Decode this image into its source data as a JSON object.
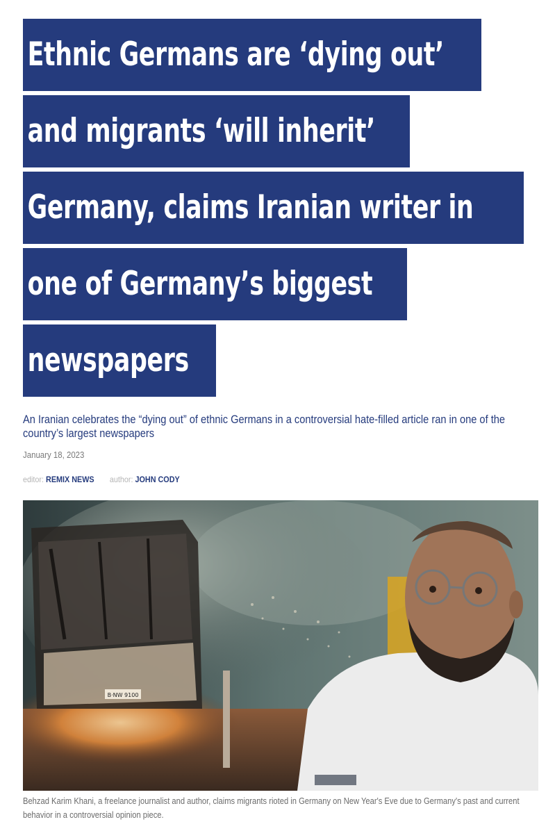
{
  "article": {
    "headline_lines": [
      "Ethnic Germans are ‘dying out’",
      "and migrants ‘will inherit’",
      "Germany, claims Iranian writer in",
      "one of Germany’s biggest",
      "newspapers"
    ],
    "subtitle": "An Iranian celebrates the “dying out” of ethnic Germans in a controversial hate-filled article ran in one of the country’s largest newspapers",
    "date": "January 18, 2023",
    "editor_label": "editor:",
    "editor_name": "REMIX NEWS",
    "author_label": "author:",
    "author_name": "JOHN CODY",
    "photo": {
      "license_plate": "B·NW 9100"
    },
    "caption": "Behzad Karim Khani, a freelance journalist and author, claims migrants rioted in Germany on New Year's Eve due to Germany's past and current behavior in a controversial opinion piece."
  },
  "colors": {
    "headline_bg": "#253b7d",
    "headline_text": "#ffffff",
    "accent": "#253b7d",
    "meta_gray": "#7a7a7a"
  }
}
